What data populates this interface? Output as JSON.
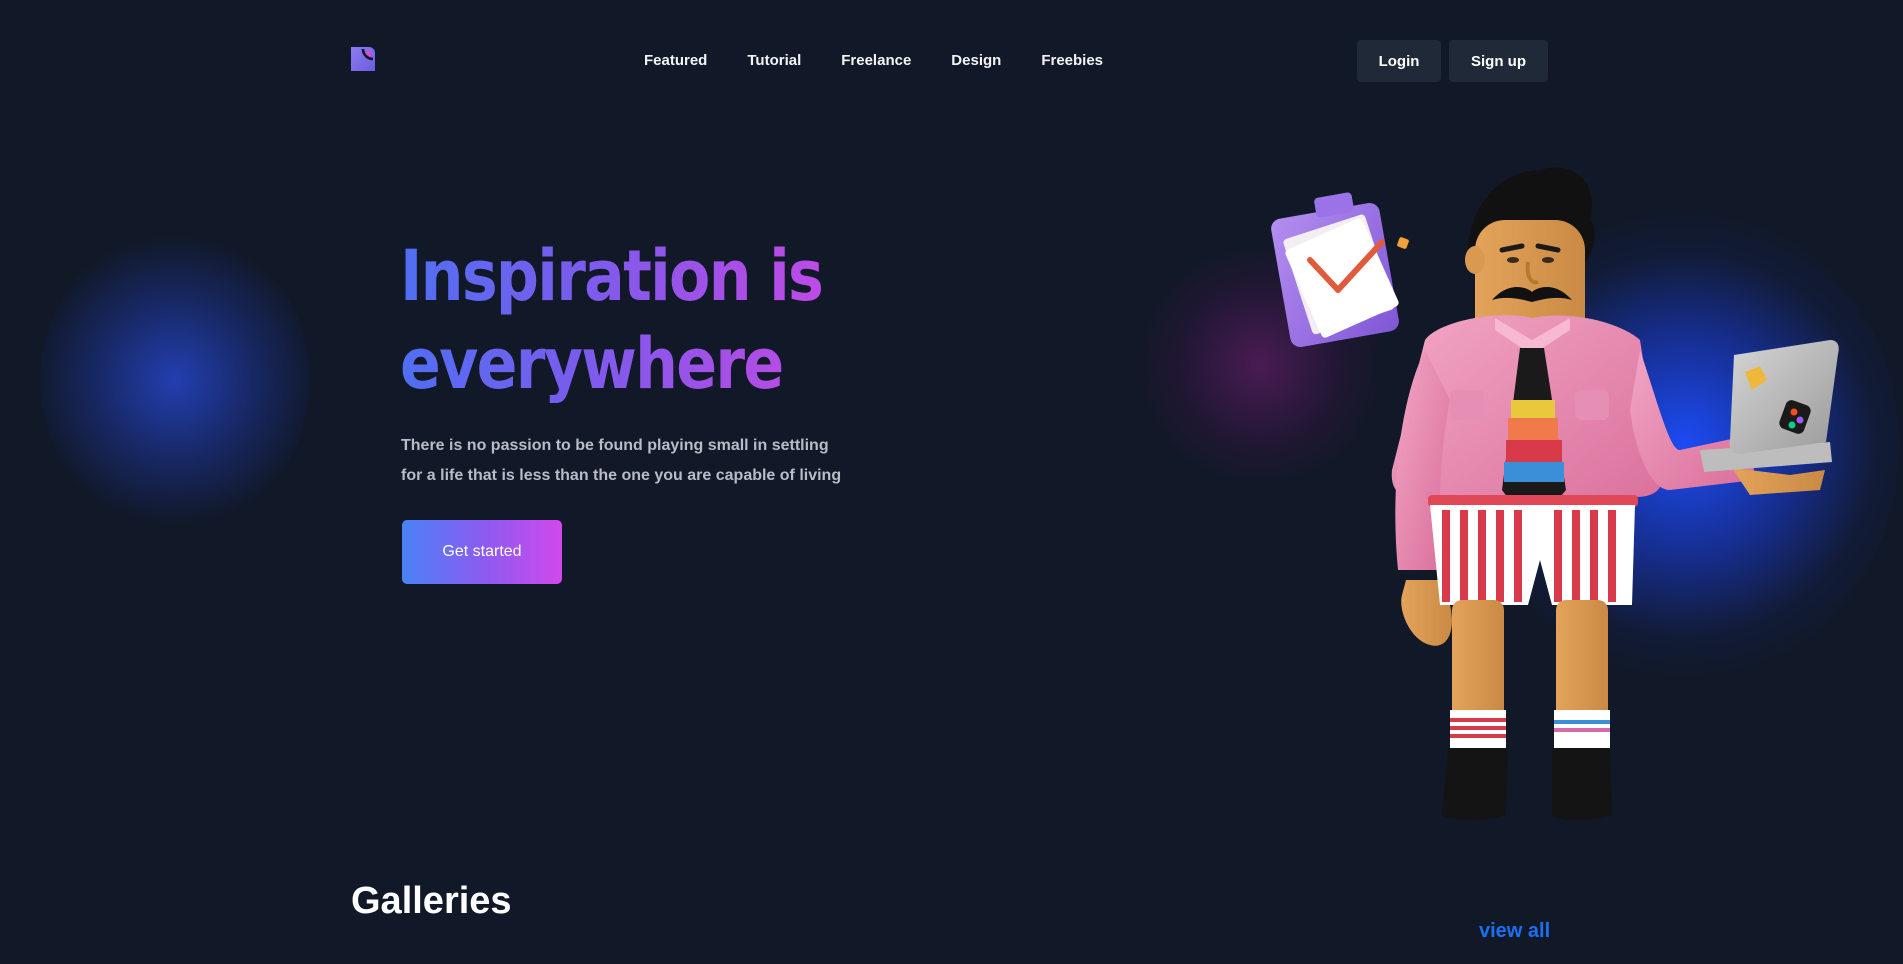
{
  "nav": {
    "links": [
      "Featured",
      "Tutorial",
      "Freelance",
      "Design",
      "Freebies"
    ],
    "login_label": "Login",
    "signup_label": "Sign up"
  },
  "hero": {
    "title_line1": "Inspiration is",
    "title_line2": "everywhere",
    "subtitle_line1": "There is no passion to be found playing small in settling",
    "subtitle_line2": "for a life that is less than the one you are capable of living",
    "cta_label": "Get started"
  },
  "galleries": {
    "heading": "Galleries",
    "view_all_label": "view all"
  },
  "colors": {
    "background": "#111827",
    "button_bg": "#1f2937",
    "gradient_start": "#4a82f5",
    "gradient_end": "#d148ec",
    "link_blue": "#1d6ff2"
  },
  "icons": {
    "logo": "logo-icon",
    "illustration": "character-illustration"
  }
}
